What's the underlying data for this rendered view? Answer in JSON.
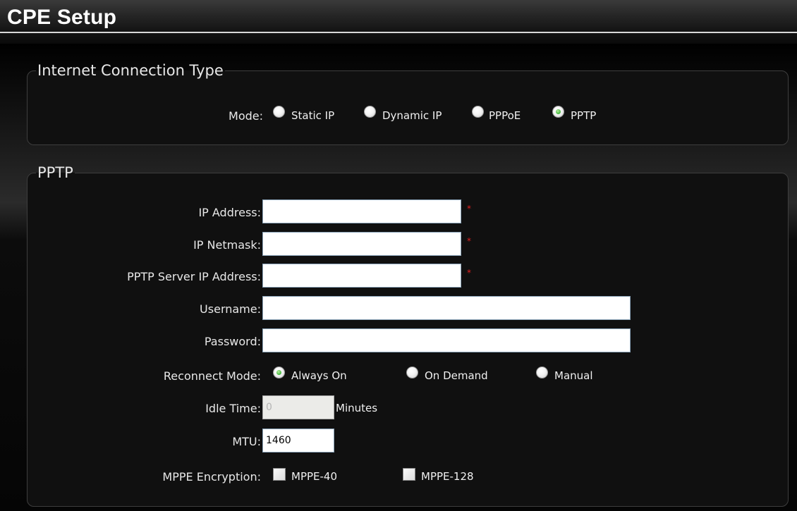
{
  "header": {
    "title": "CPE Setup"
  },
  "connection_type": {
    "legend": "Internet Connection Type",
    "mode_label": "Mode:",
    "options": [
      {
        "label": "Static IP",
        "checked": false
      },
      {
        "label": "Dynamic IP",
        "checked": false
      },
      {
        "label": "PPPoE",
        "checked": false
      },
      {
        "label": "PPTP",
        "checked": true
      }
    ]
  },
  "pptp": {
    "legend": "PPTP",
    "required_mark": "*",
    "ip_address": {
      "label": "IP Address:",
      "value": ""
    },
    "ip_netmask": {
      "label": "IP Netmask:",
      "value": ""
    },
    "server_ip": {
      "label": "PPTP Server IP Address:",
      "value": ""
    },
    "username": {
      "label": "Username:",
      "value": ""
    },
    "password": {
      "label": "Password:",
      "value": ""
    },
    "reconnect": {
      "label": "Reconnect Mode:",
      "options": [
        {
          "label": "Always On",
          "checked": true
        },
        {
          "label": "On Demand",
          "checked": false
        },
        {
          "label": "Manual",
          "checked": false
        }
      ]
    },
    "idle_time": {
      "label": "Idle Time:",
      "value": "0",
      "unit": "Minutes"
    },
    "mtu": {
      "label": "MTU:",
      "value": "1460"
    },
    "mppe": {
      "label": "MPPE Encryption:",
      "options": [
        {
          "label": "MPPE-40",
          "checked": false
        },
        {
          "label": "MPPE-128",
          "checked": false
        }
      ]
    }
  },
  "colors": {
    "background": "#000000",
    "radio_selected": "#3fb63a",
    "required": "#e02020"
  }
}
